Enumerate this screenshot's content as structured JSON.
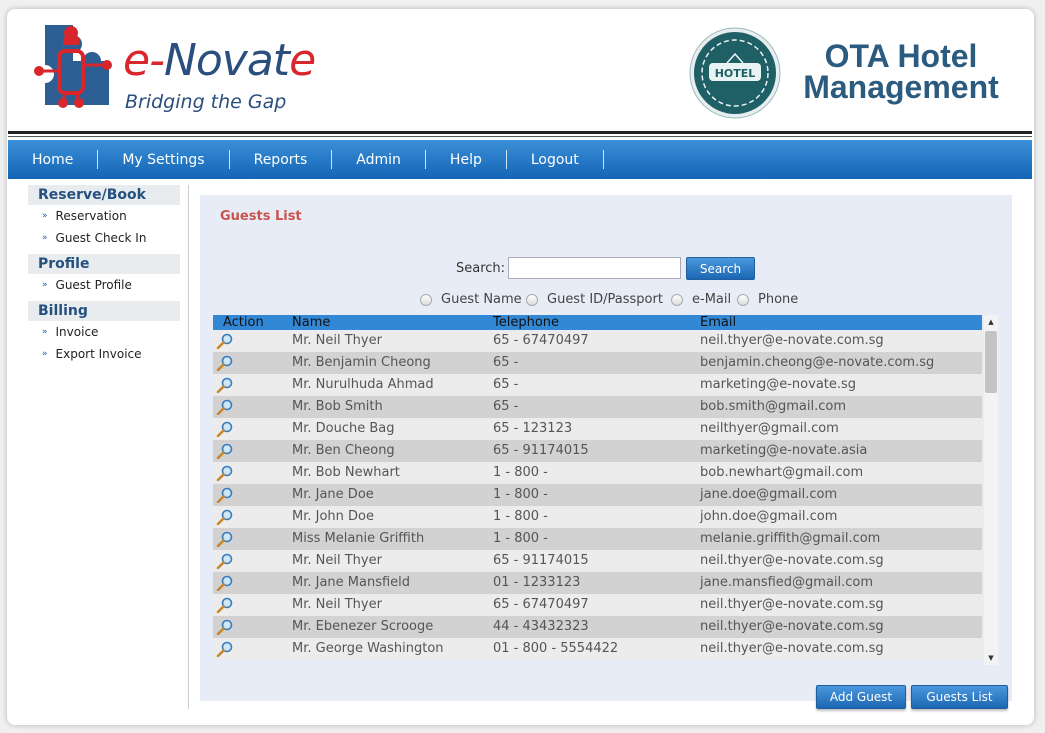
{
  "brand": {
    "logo_word_e": "e-",
    "logo_word_n": "N",
    "logo_word_ovat": "ovat",
    "logo_word_end": "e",
    "tagline": "Bridging the Gap",
    "hotel_badge_text": "HOTEL",
    "app_title_line1": "OTA Hotel",
    "app_title_line2": "Management"
  },
  "nav": {
    "items": [
      {
        "label": "Home"
      },
      {
        "label": "My Settings"
      },
      {
        "label": "Reports"
      },
      {
        "label": "Admin"
      },
      {
        "label": "Help"
      },
      {
        "label": "Logout"
      }
    ]
  },
  "sidebar": {
    "sections": [
      {
        "title": "Reserve/Book",
        "items": [
          "Reservation",
          "Guest Check In"
        ]
      },
      {
        "title": "Profile",
        "items": [
          "Guest Profile"
        ]
      },
      {
        "title": "Billing",
        "items": [
          "Invoice",
          "Export Invoice"
        ]
      }
    ]
  },
  "main": {
    "title": "Guests List",
    "search": {
      "label": "Search:",
      "value": "",
      "button": "Search",
      "options": [
        "Guest Name",
        "Guest ID/Passport",
        "e-Mail",
        "Phone"
      ]
    },
    "table": {
      "columns": [
        "Action",
        "Name",
        "Telephone",
        "Email"
      ],
      "rows": [
        [
          "Mr. Neil Thyer",
          "65 - 67470497",
          "neil.thyer@e-novate.com.sg"
        ],
        [
          "Mr. Benjamin Cheong",
          "65 -",
          "benjamin.cheong@e-novate.com.sg"
        ],
        [
          "Mr. Nurulhuda Ahmad",
          "65 -",
          "marketing@e-novate.sg"
        ],
        [
          "Mr. Bob Smith",
          "65 -",
          "bob.smith@gmail.com"
        ],
        [
          "Mr. Douche Bag",
          "65 - 123123",
          "neilthyer@gmail.com"
        ],
        [
          "Mr. Ben Cheong",
          "65 - 91174015",
          "marketing@e-novate.asia"
        ],
        [
          "Mr. Bob Newhart",
          "1 - 800 -",
          "bob.newhart@gmail.com"
        ],
        [
          "Mr. Jane Doe",
          "1 - 800 -",
          "jane.doe@gmail.com"
        ],
        [
          "Mr. John Doe",
          "1 - 800 -",
          "john.doe@gmail.com"
        ],
        [
          "Miss Melanie Griffith",
          "1 - 800 -",
          "melanie.griffith@gmail.com"
        ],
        [
          "Mr. Neil Thyer",
          "65 - 91174015",
          "neil.thyer@e-novate.com.sg"
        ],
        [
          "Mr. Jane Mansfield",
          "01 - 1233123",
          "jane.mansfied@gmail.com"
        ],
        [
          "Mr. Neil Thyer",
          "65 - 67470497",
          "neil.thyer@e-novate.com.sg"
        ],
        [
          "Mr. Ebenezer Scrooge",
          "44 - 43432323",
          "neil.thyer@e-novate.com.sg"
        ],
        [
          "Mr. George Washington",
          "01 - 800 - 5554422",
          "neil.thyer@e-novate.com.sg"
        ]
      ]
    },
    "buttons": {
      "add_guest": "Add Guest",
      "guests_list": "Guests List"
    }
  },
  "colors": {
    "nav": "#1a6bb8",
    "brand_blue": "#2a4f7e",
    "brand_red": "#d9262c",
    "title_red": "#c8544c",
    "table_header": "#3388d6"
  }
}
